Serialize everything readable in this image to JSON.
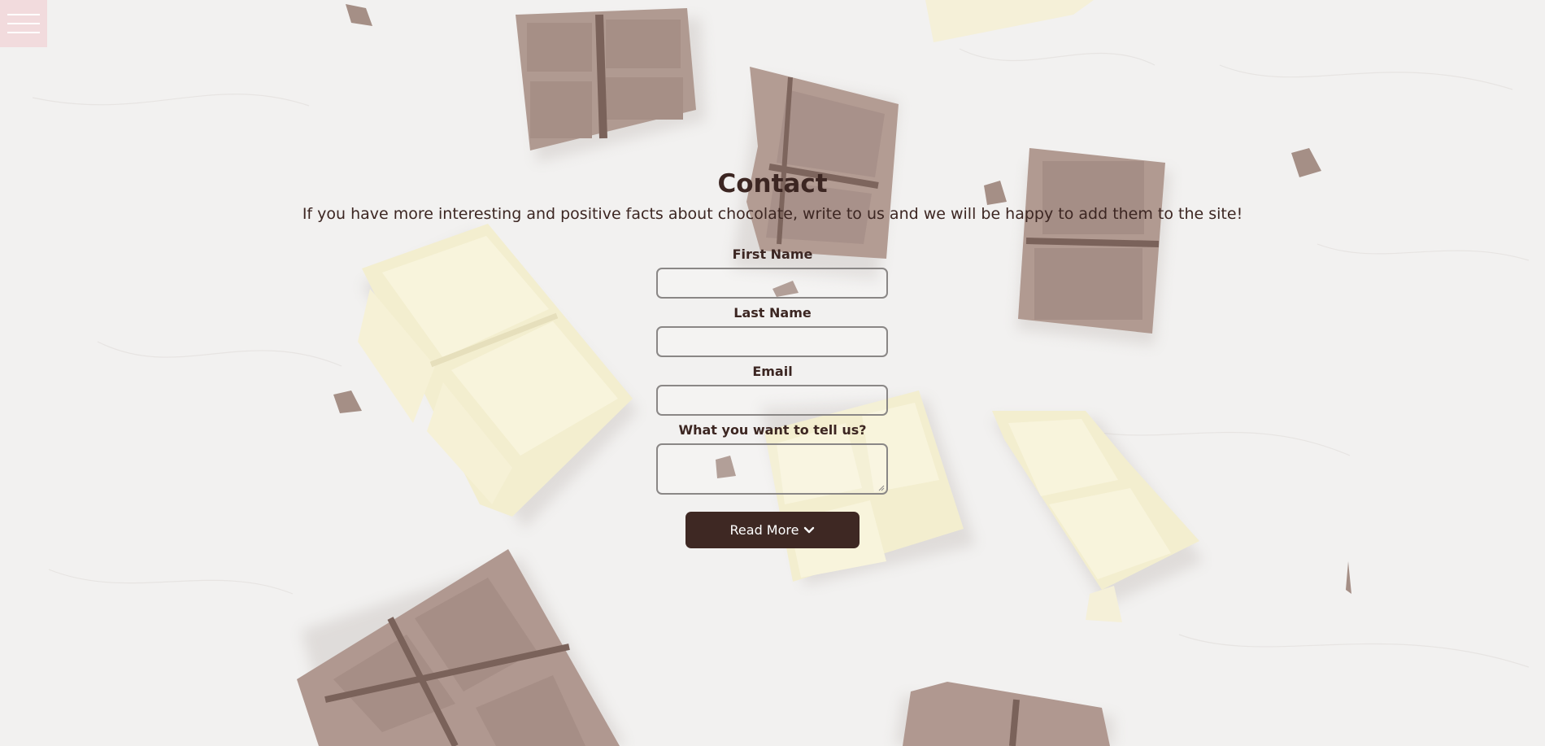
{
  "menu": {
    "icon": "hamburger-menu-icon"
  },
  "contact": {
    "title": "Contact",
    "subtitle": "If you have more interesting and positive facts about chocolate, write to us and we will be happy to add them to the site!"
  },
  "form": {
    "first_name_label": "First Name",
    "first_name_value": "",
    "last_name_label": "Last Name",
    "last_name_value": "",
    "email_label": "Email",
    "email_value": "",
    "message_label": "What you want to tell us?",
    "message_value": "",
    "submit_label": "Read More",
    "submit_icon": "chevron-down-icon"
  },
  "colors": {
    "text": "#3c2622",
    "button_bg": "#3e2823",
    "button_text": "#ffffff",
    "input_border": "#8a8786",
    "menu_bg": "#f2c8ce",
    "background": "#f1f0ef"
  }
}
